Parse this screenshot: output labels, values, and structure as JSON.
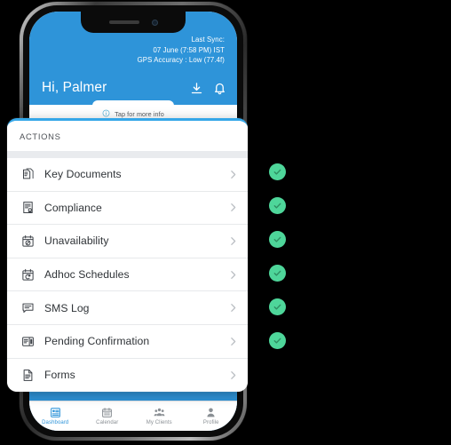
{
  "app": {
    "header": {
      "sync_lines": [
        "Last Sync:",
        "07 June (7:58 PM) IST",
        "GPS Accuracy : Low (77.4f)"
      ],
      "greeting": "Hi, Palmer",
      "download_icon": "download-icon",
      "bell_icon": "bell-icon"
    },
    "info_strip": {
      "icon": "info-icon",
      "text": "Tap for more info"
    },
    "actions": {
      "title": "ACTIONS",
      "items": [
        {
          "label": "Key Documents",
          "icon": "documents-icon",
          "checked": true
        },
        {
          "label": "Compliance",
          "icon": "certificate-icon",
          "checked": true
        },
        {
          "label": "Unavailability",
          "icon": "calendar-blocked-icon",
          "checked": true
        },
        {
          "label": "Adhoc Schedules",
          "icon": "calendar-refresh-icon",
          "checked": true
        },
        {
          "label": "SMS Log",
          "icon": "chat-bubble-icon",
          "checked": true
        },
        {
          "label": "Pending Confirmation",
          "icon": "id-card-icon",
          "checked": true
        },
        {
          "label": "Forms",
          "icon": "document-icon",
          "checked": false
        }
      ],
      "chevron_icon": "chevron-right-icon",
      "check_icon": "check-icon"
    },
    "bottom_nav": [
      {
        "label": "Dashboard",
        "icon": "dashboard-icon",
        "active": true
      },
      {
        "label": "Calendar",
        "icon": "calendar-icon",
        "active": false
      },
      {
        "label": "My Clients",
        "icon": "people-icon",
        "active": false
      },
      {
        "label": "Profile",
        "icon": "person-icon",
        "active": false
      }
    ]
  },
  "colors": {
    "brand_blue": "#2e94d9",
    "card_top_border": "#35a7e8",
    "check_green": "#4ed69a",
    "background": "#000000",
    "text_primary": "#2f3337",
    "text_muted": "#8a8f94"
  }
}
